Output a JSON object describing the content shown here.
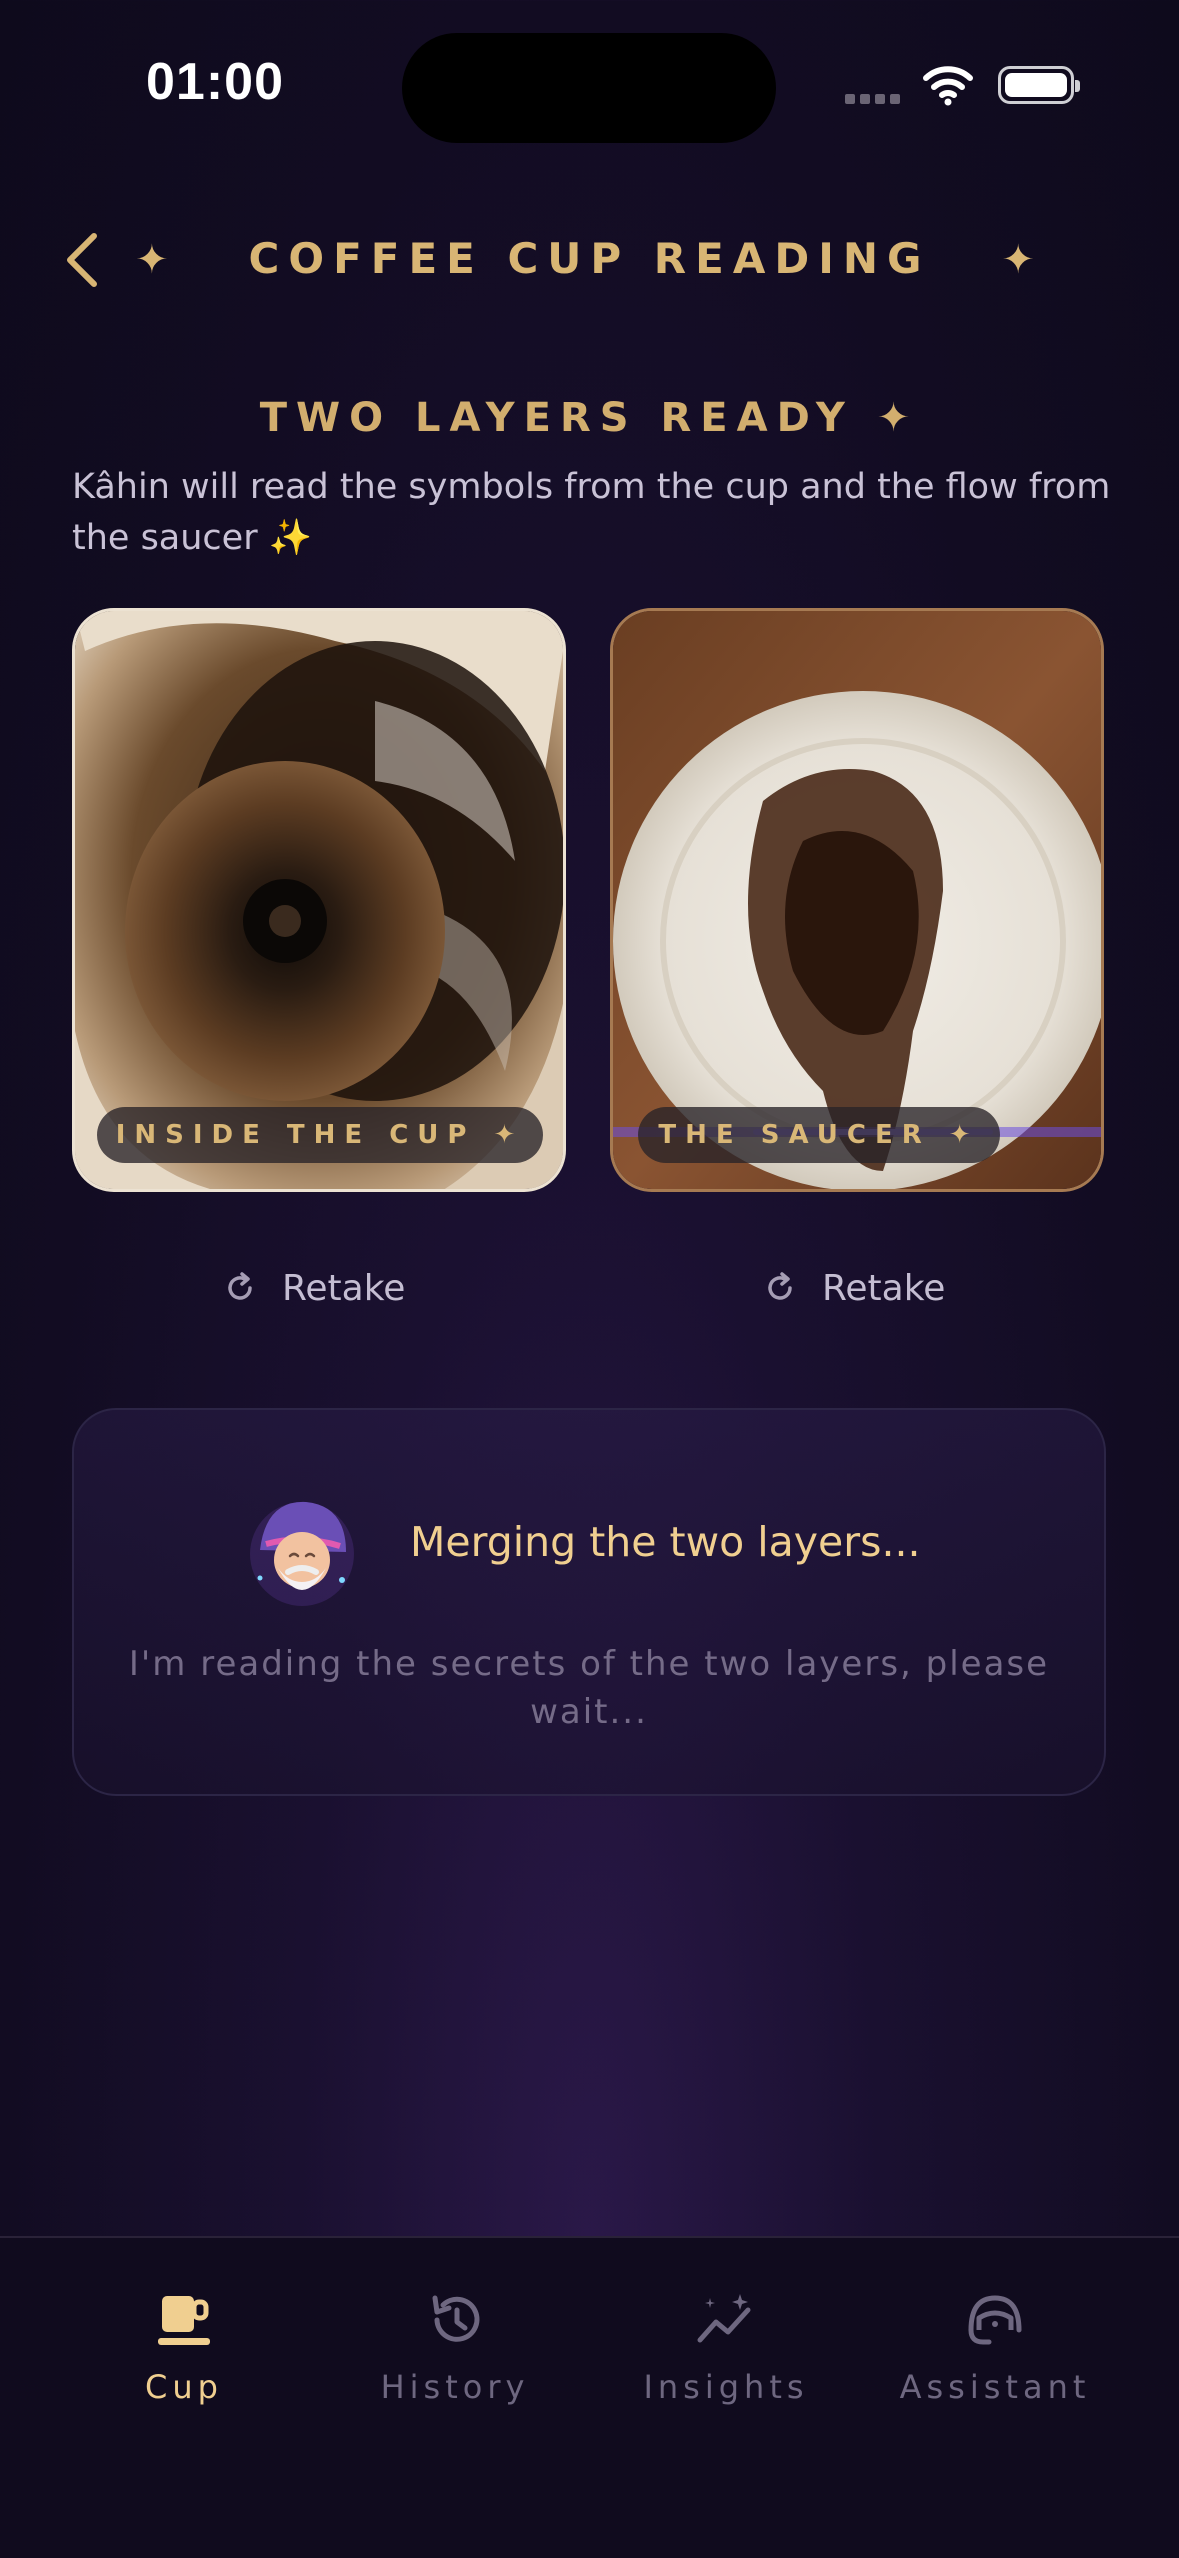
{
  "status_bar": {
    "time": "01:00"
  },
  "header": {
    "title": "COFFEE CUP READING",
    "star": "✦"
  },
  "intro": {
    "title": "TWO LAYERS READY ✦",
    "description": "Kâhin will read the symbols from the cup and the flow from the saucer ✨"
  },
  "photos": [
    {
      "label": "INSIDE THE CUP ✦",
      "retake": "Retake"
    },
    {
      "label": "THE SAUCER ✦",
      "retake": "Retake"
    }
  ],
  "status_panel": {
    "title": "Merging the two layers...",
    "message": "I'm reading the secrets of the two layers, please wait..."
  },
  "tabs": [
    {
      "label": "Cup",
      "icon": "cup-icon",
      "active": true
    },
    {
      "label": "History",
      "icon": "history-icon",
      "active": false
    },
    {
      "label": "Insights",
      "icon": "insights-icon",
      "active": false
    },
    {
      "label": "Assistant",
      "icon": "assistant-icon",
      "active": false
    }
  ],
  "colors": {
    "gold": "#d8b574",
    "background": "#120c22",
    "inactive_tab": "#6e6780"
  }
}
